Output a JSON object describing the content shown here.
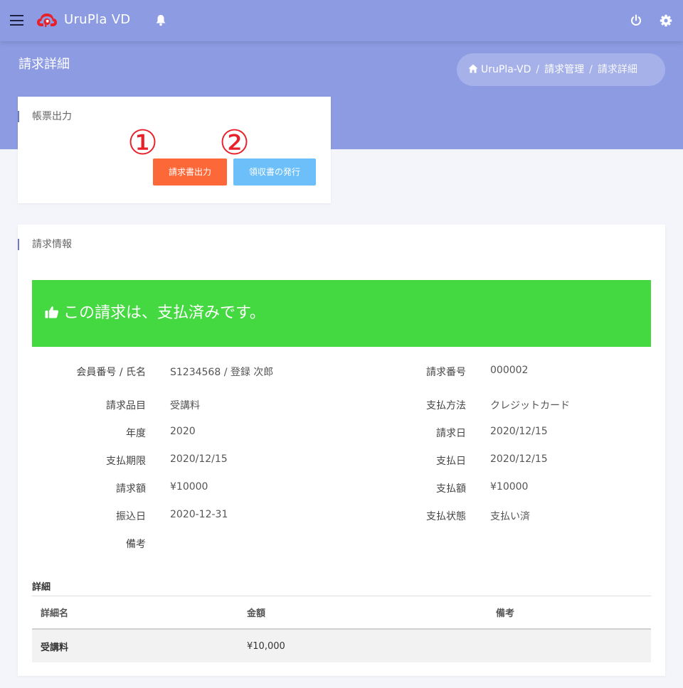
{
  "topbar": {
    "app_title": "UruPla VD",
    "icons": [
      "menu-icon",
      "logo-icon",
      "bell-icon",
      "power-icon",
      "gear-icon"
    ]
  },
  "header": {
    "page_title": "請求詳細",
    "breadcrumb": [
      "UruPla-VD",
      "請求管理",
      "請求詳細"
    ]
  },
  "output_card": {
    "title": "帳票出力",
    "markers": [
      "①",
      "②"
    ],
    "invoice_button": "請求書出力",
    "receipt_button": "領収書の発行"
  },
  "info_card": {
    "title": "請求情報",
    "banner_text": "この請求は、支払済みです。",
    "left_fields": [
      {
        "label": "会員番号 / 氏名",
        "value": "S1234568 / 登録 次郎"
      },
      {
        "label": "請求品目",
        "value": "受講料"
      },
      {
        "label": "年度",
        "value": "2020"
      },
      {
        "label": "支払期限",
        "value": "2020/12/15"
      },
      {
        "label": "請求額",
        "value": "¥10000"
      },
      {
        "label": "振込日",
        "value": "2020-12-31"
      },
      {
        "label": "備考",
        "value": ""
      }
    ],
    "right_fields": [
      {
        "label": "請求番号",
        "value": "000002"
      },
      {
        "label": "支払方法",
        "value": "クレジットカード"
      },
      {
        "label": "請求日",
        "value": "2020/12/15"
      },
      {
        "label": "支払日",
        "value": "2020/12/15"
      },
      {
        "label": "支払額",
        "value": "¥10000"
      },
      {
        "label": "支払状態",
        "value": "支払い済"
      }
    ],
    "detail": {
      "title": "詳細",
      "headers": [
        "詳細名",
        "金額",
        "備考"
      ],
      "rows": [
        [
          "受講料",
          "¥10,000",
          ""
        ]
      ]
    }
  },
  "colors": {
    "header_bg": "#8c9be2",
    "banner_green": "#44d940",
    "invoice_orange": "#fd6838",
    "receipt_blue": "#6cbff9",
    "marker_red": "#e8202a"
  }
}
